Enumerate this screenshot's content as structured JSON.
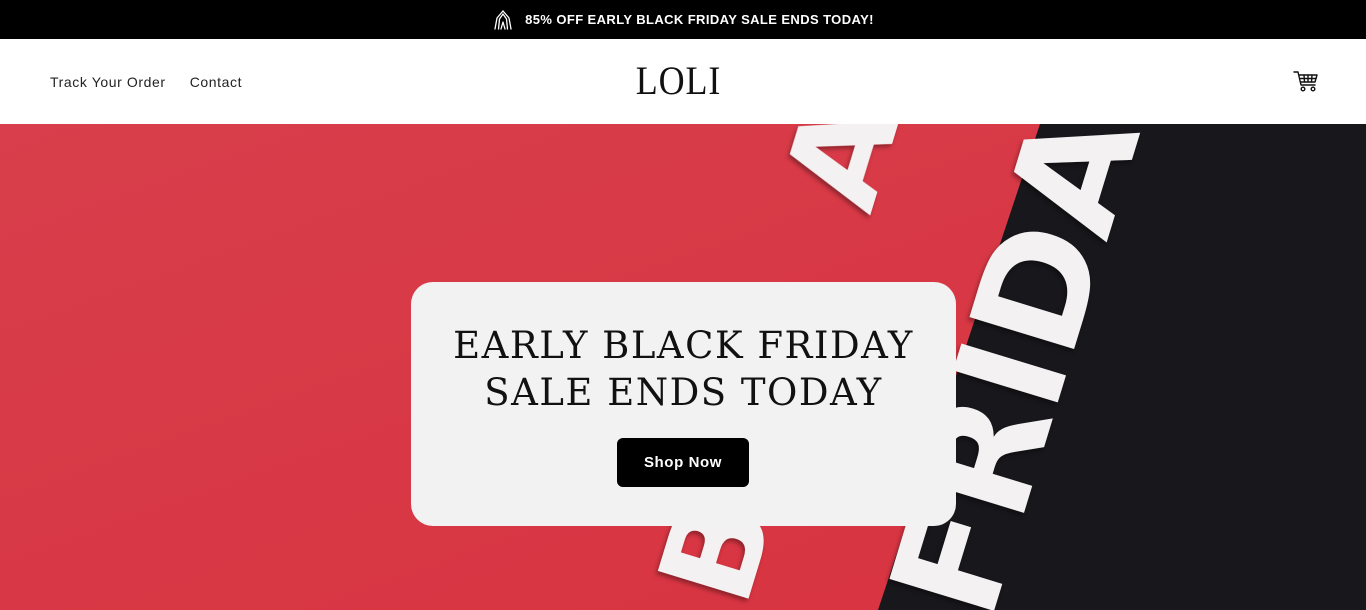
{
  "announcement": {
    "text": "85% OFF EARLY BLACK FRIDAY SALE ENDS TODAY!",
    "icon": "hands-logo-icon"
  },
  "header": {
    "nav": [
      {
        "label": "Track Your Order"
      },
      {
        "label": "Contact"
      }
    ],
    "logo": "LOLI",
    "cart_icon": "cart-icon"
  },
  "hero": {
    "heading_line1": "EARLY BLACK FRIDAY",
    "heading_line2": "SALE ENDS TODAY",
    "cta_label": "Shop Now",
    "background_letters": "BLACK FRIDAY",
    "colors": {
      "red": "#d93a47",
      "black": "#18171b",
      "letters": "#f3f1f2",
      "card": "#f2f2f2"
    }
  }
}
